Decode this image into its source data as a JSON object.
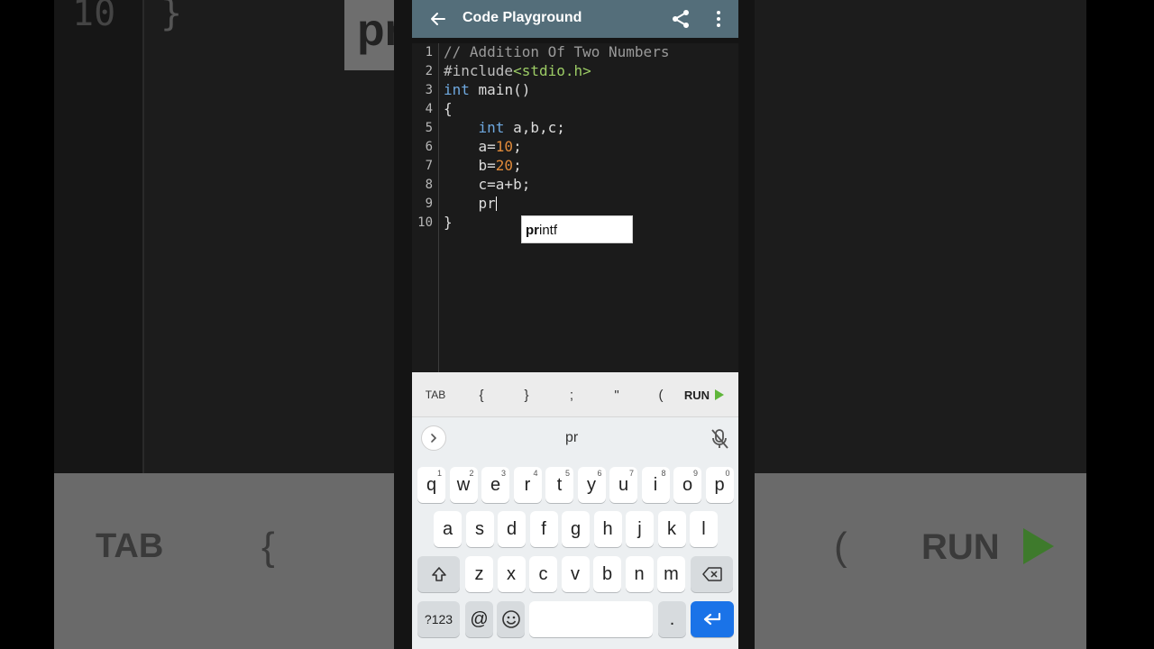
{
  "app": {
    "title": "Code Playground"
  },
  "editor": {
    "line_numbers": [
      "1",
      "2",
      "3",
      "4",
      "5",
      "6",
      "7",
      "8",
      "9",
      "10"
    ],
    "lines": [
      [
        {
          "t": "// Addition Of Two Numbers",
          "c": "c-comment"
        }
      ],
      [
        {
          "t": "#include",
          "c": "c-pre"
        },
        {
          "t": "<stdio.h>",
          "c": "c-str"
        }
      ],
      [
        {
          "t": "int",
          "c": "c-kw"
        },
        {
          "t": " main()",
          "c": "c-plain"
        }
      ],
      [
        {
          "t": "{",
          "c": "c-plain"
        }
      ],
      [
        {
          "t": "    ",
          "c": "c-plain"
        },
        {
          "t": "int",
          "c": "c-kw"
        },
        {
          "t": " a,b,c;",
          "c": "c-plain"
        }
      ],
      [
        {
          "t": "    a=",
          "c": "c-plain"
        },
        {
          "t": "10",
          "c": "c-num"
        },
        {
          "t": ";",
          "c": "c-plain"
        }
      ],
      [
        {
          "t": "    b=",
          "c": "c-plain"
        },
        {
          "t": "20",
          "c": "c-num"
        },
        {
          "t": ";",
          "c": "c-plain"
        }
      ],
      [
        {
          "t": "    c=a+b;",
          "c": "c-plain"
        }
      ],
      [
        {
          "t": "    pr",
          "c": "c-plain"
        }
      ],
      [
        {
          "t": "}",
          "c": "c-plain"
        }
      ]
    ],
    "autocomplete": {
      "match": "pr",
      "rest": "intf"
    }
  },
  "key_row": {
    "tab": "TAB",
    "open_brace": "{",
    "close_brace": "}",
    "semicolon": ";",
    "quote": "\"",
    "open_paren": "(",
    "run": "RUN"
  },
  "keyboard": {
    "suggestion": "pr",
    "row1": [
      {
        "k": "q",
        "s": "1"
      },
      {
        "k": "w",
        "s": "2"
      },
      {
        "k": "e",
        "s": "3"
      },
      {
        "k": "r",
        "s": "4"
      },
      {
        "k": "t",
        "s": "5"
      },
      {
        "k": "y",
        "s": "6"
      },
      {
        "k": "u",
        "s": "7"
      },
      {
        "k": "i",
        "s": "8"
      },
      {
        "k": "o",
        "s": "9"
      },
      {
        "k": "p",
        "s": "0"
      }
    ],
    "row2": [
      "a",
      "s",
      "d",
      "f",
      "g",
      "h",
      "j",
      "k",
      "l"
    ],
    "row3": [
      "z",
      "x",
      "c",
      "v",
      "b",
      "n",
      "m"
    ],
    "symbols_key": "?123",
    "at_key": "@",
    "period_key": "."
  },
  "background": {
    "line_number": "10",
    "brace": "}",
    "popup_text": "pr",
    "tab": "TAB",
    "open_brace": "{",
    "open_paren": "(",
    "run": "RUN"
  },
  "colors": {
    "appbar": "#546e7a",
    "editor_bg": "#1b1b1b",
    "keyword": "#6ea8df",
    "number": "#e08a3a",
    "string": "#9ccc65",
    "run_play": "#5fb63a",
    "enter_key": "#1a73e8"
  }
}
